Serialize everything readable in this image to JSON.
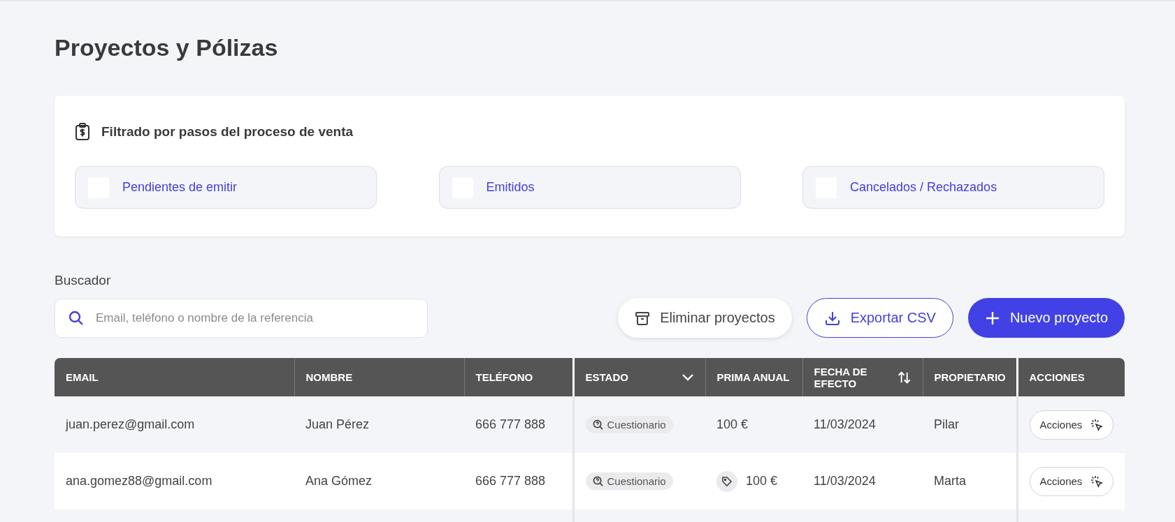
{
  "page_title": "Proyectos y Pólizas",
  "filter_card": {
    "title": "Filtrado por pasos del proceso de venta",
    "options": [
      {
        "label": "Pendientes de emitir",
        "checked": false
      },
      {
        "label": "Emitidos",
        "checked": false
      },
      {
        "label": "Cancelados / Rechazados",
        "checked": false
      }
    ]
  },
  "search": {
    "label": "Buscador",
    "placeholder": "Email, teléfono o nombre de la referencia"
  },
  "buttons": [
    {
      "kind": "delete",
      "label": "Eliminar proyectos"
    },
    {
      "kind": "export",
      "label": "Exportar CSV"
    },
    {
      "kind": "new",
      "label": "Nuevo proyecto"
    }
  ],
  "table": {
    "columns": [
      {
        "label": "EMAIL",
        "kind": "plain"
      },
      {
        "label": "NOMBRE",
        "kind": "plain"
      },
      {
        "label": "TELÉFONO",
        "kind": "plain"
      },
      {
        "label": "ESTADO",
        "kind": "dropdown"
      },
      {
        "label": "PRIMA ANUAL",
        "kind": "plain"
      },
      {
        "label": "FECHA DE EFECTO",
        "kind": "sort"
      },
      {
        "label": "PROPIETARIO",
        "kind": "plain"
      },
      {
        "label": "ACCIONES",
        "kind": "plain"
      }
    ],
    "rows": [
      {
        "email": "juan.perez@gmail.com",
        "nombre": "Juan Pérez",
        "telefono": "666 777 888",
        "estado": "Cuestionario",
        "prima": "100 €",
        "prima_tagged": false,
        "fecha": "11/03/2024",
        "propietario": "Pilar",
        "accion": "Acciones"
      },
      {
        "email": "ana.gomez88@gmail.com",
        "nombre": "Ana Gómez",
        "telefono": "666 777 888",
        "estado": "Cuestionario",
        "prima": "100 €",
        "prima_tagged": true,
        "fecha": "11/03/2024",
        "propietario": "Marta",
        "accion": "Acciones"
      }
    ]
  }
}
